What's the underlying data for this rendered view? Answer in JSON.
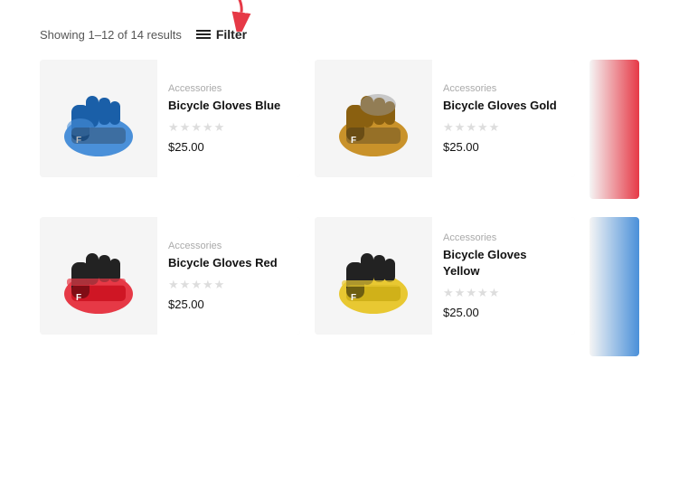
{
  "header": {
    "showing_text": "Showing 1–12 of 14 results",
    "filter_label": "Filter"
  },
  "products": [
    {
      "id": "p1",
      "category": "Accessories",
      "name": "Bicycle Gloves Blue",
      "price": "$25.00",
      "stars": [
        0,
        0,
        0,
        0,
        0
      ],
      "color": "blue",
      "row": 0,
      "col": 0
    },
    {
      "id": "p2",
      "category": "Accessories",
      "name": "Bicycle Gloves Gold",
      "price": "$25.00",
      "stars": [
        0,
        0,
        0,
        0,
        0
      ],
      "color": "gold",
      "row": 0,
      "col": 1
    },
    {
      "id": "p3",
      "category": "Accessories",
      "name": "Bicycle Gloves Red",
      "price": "$25.00",
      "stars": [
        0,
        0,
        0,
        0,
        0
      ],
      "color": "red",
      "row": 1,
      "col": 0
    },
    {
      "id": "p4",
      "category": "Accessories",
      "name": "Bicycle Gloves Yellow",
      "price": "$25.00",
      "stars": [
        0,
        0,
        0,
        0,
        0
      ],
      "color": "yellow",
      "row": 1,
      "col": 1
    }
  ],
  "partial_cards": [
    {
      "color_class": "partial-card-red",
      "row": 0
    },
    {
      "color_class": "partial-card-blue",
      "row": 1
    }
  ]
}
